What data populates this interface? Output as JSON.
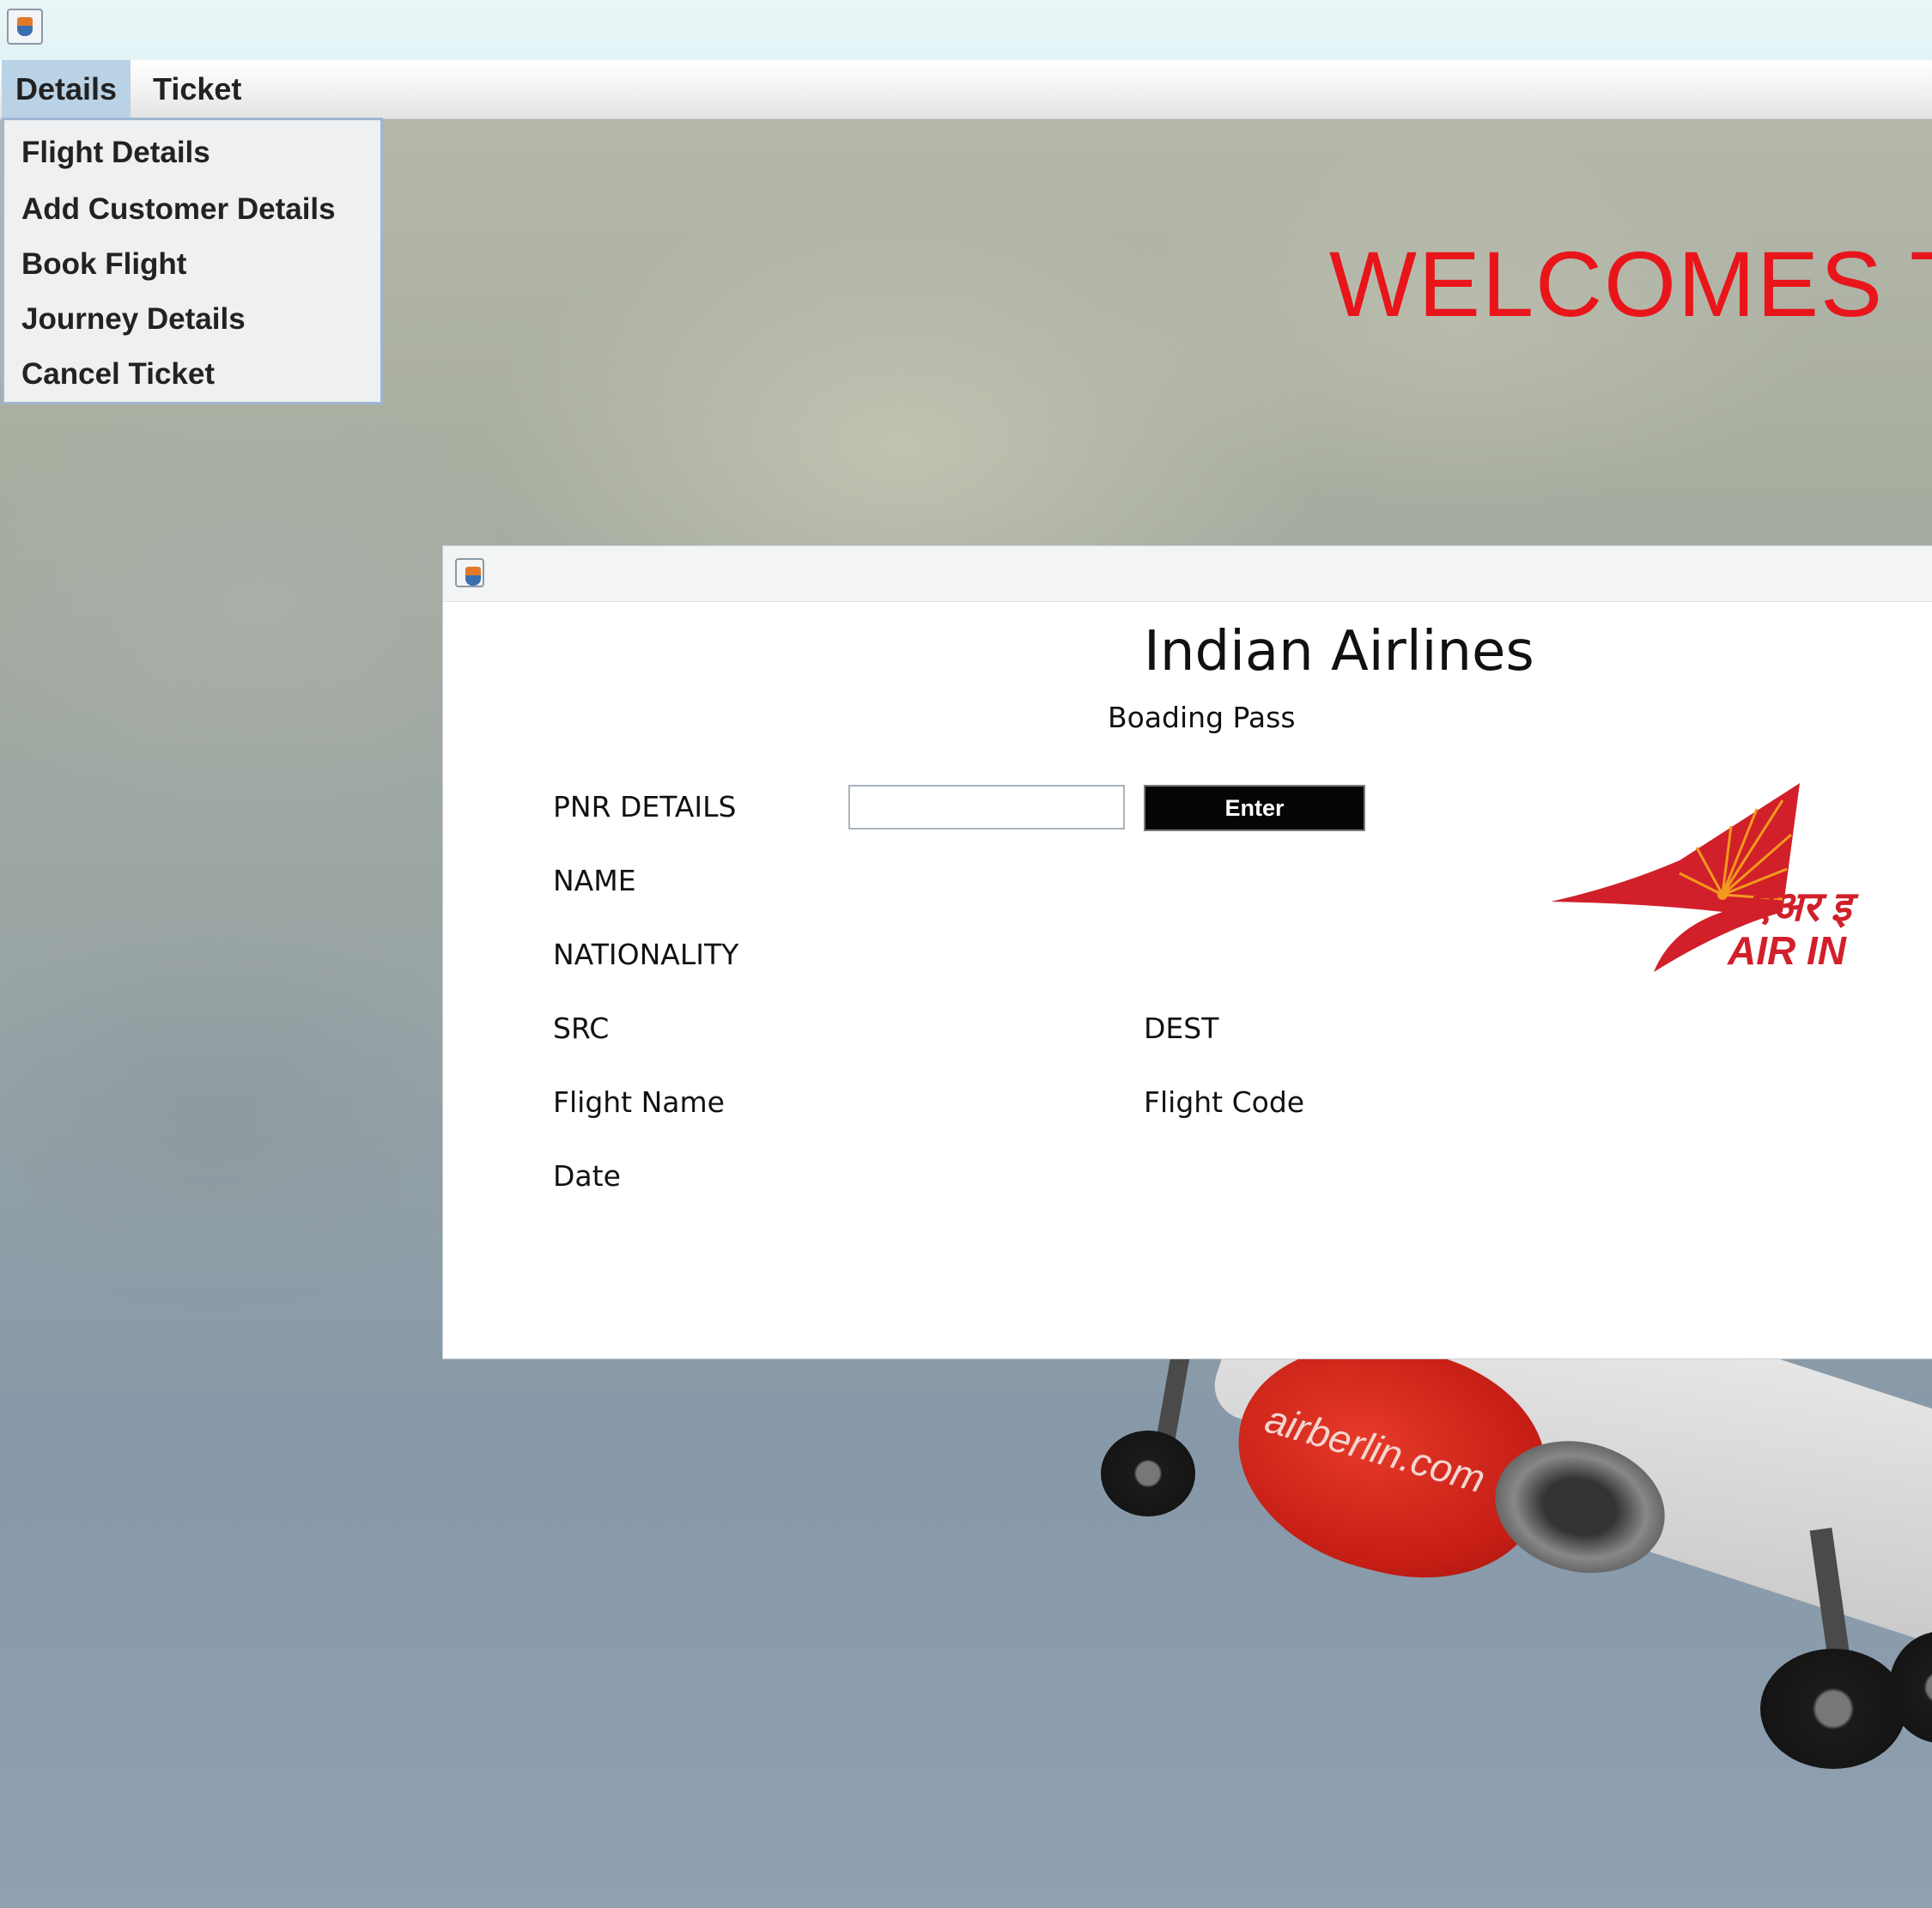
{
  "window": {
    "icon": "java-cup-icon"
  },
  "menubar": {
    "details_label": "Details",
    "ticket_label": "Ticket"
  },
  "details_menu": {
    "items": [
      {
        "label": "Flight Details"
      },
      {
        "label": "Add Customer Details"
      },
      {
        "label": "Book Flight"
      },
      {
        "label": "Journey Details"
      },
      {
        "label": "Cancel Ticket"
      }
    ]
  },
  "background": {
    "welcome_text": "WELCOMES T",
    "engine_branding": "airberlin.com",
    "welcome_color": "#e8151b"
  },
  "dialog": {
    "icon": "java-cup-icon",
    "heading": "Indian Airlines",
    "subheading": "Boading Pass",
    "pnr_label": "PNR DETAILS",
    "pnr_value": "",
    "enter_label": "Enter",
    "name_label": "NAME",
    "nationality_label": "NATIONALITY",
    "src_label": "SRC",
    "dest_label": "DEST",
    "flight_name_label": "Flight Name",
    "flight_code_label": "Flight Code",
    "date_label": "Date",
    "logo": {
      "hindi_text": "एअर इ",
      "english_text": "AIR IN",
      "color": "#d1202a",
      "accent": "#f39a1e"
    }
  }
}
